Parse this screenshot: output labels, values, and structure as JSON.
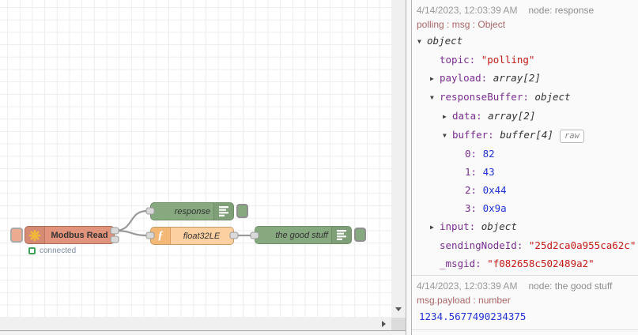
{
  "flow": {
    "nodes": [
      {
        "label": "Modbus Read",
        "color": "#E2937B",
        "icon": "modbus-gear-icon",
        "status": "connected"
      },
      {
        "label": "response",
        "color": "#87A980",
        "icon": "debug-lines-icon"
      },
      {
        "label": "float32LE",
        "color": "#FDD0A2",
        "icon": "function-icon"
      },
      {
        "label": "the good stuff",
        "color": "#87A980",
        "icon": "debug-lines-icon"
      }
    ],
    "wire_color": "#999999",
    "status_green": "#3fa257"
  },
  "debug": {
    "messages": [
      {
        "timestamp": "4/14/2023, 12:03:39 AM",
        "node": "node: response",
        "path": "polling : msg : Object",
        "tree": [
          {
            "arrow": "down",
            "level": 0,
            "key": "",
            "value": "object",
            "vtype": "type"
          },
          {
            "arrow": "",
            "level": 1,
            "key": "topic",
            "value": "\"polling\"",
            "vtype": "string"
          },
          {
            "arrow": "right",
            "level": 1,
            "key": "payload",
            "value": "array[2]",
            "vtype": "type"
          },
          {
            "arrow": "down",
            "level": 1,
            "key": "responseBuffer",
            "value": "object",
            "vtype": "type"
          },
          {
            "arrow": "right",
            "level": 2,
            "key": "data",
            "value": "array[2]",
            "vtype": "type"
          },
          {
            "arrow": "down",
            "level": 2,
            "key": "buffer",
            "value": "buffer[4]",
            "vtype": "type",
            "button": "raw"
          },
          {
            "arrow": "",
            "level": 3,
            "key": "0",
            "value": "82",
            "vtype": "number"
          },
          {
            "arrow": "",
            "level": 3,
            "key": "1",
            "value": "43",
            "vtype": "number"
          },
          {
            "arrow": "",
            "level": 3,
            "key": "2",
            "value": "0x44",
            "vtype": "number"
          },
          {
            "arrow": "",
            "level": 3,
            "key": "3",
            "value": "0x9a",
            "vtype": "number"
          },
          {
            "arrow": "right",
            "level": 1,
            "key": "input",
            "value": "object",
            "vtype": "type"
          },
          {
            "arrow": "",
            "level": 1,
            "key": "sendingNodeId",
            "value": "\"25d2ca0a955ca62c\"",
            "vtype": "string"
          },
          {
            "arrow": "",
            "level": 1,
            "key": "_msgid",
            "value": "\"f082658c502489a2\"",
            "vtype": "string"
          }
        ]
      },
      {
        "timestamp": "4/14/2023, 12:03:39 AM",
        "node": "node: the good stuff",
        "path": "msg.payload : number",
        "value": "1234.5677490234375"
      }
    ]
  }
}
